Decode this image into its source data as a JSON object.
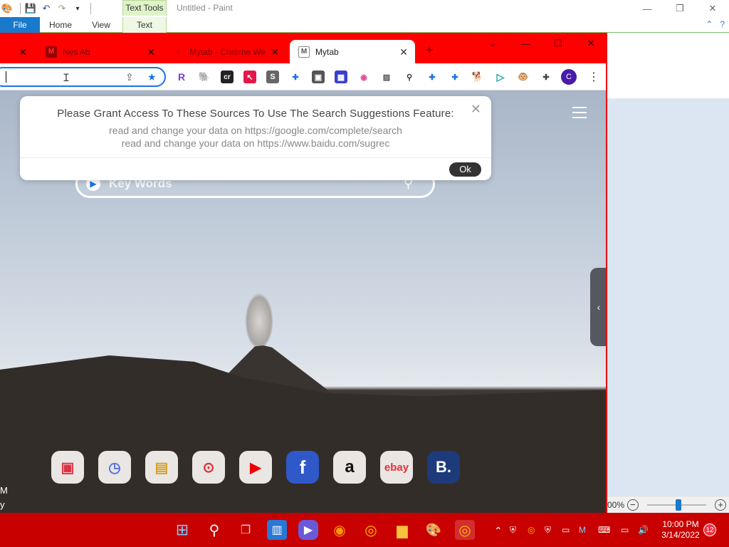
{
  "paint": {
    "title": "Untitled - Paint",
    "context_tab_group": "Text Tools",
    "ribbon_tabs": [
      "File",
      "Home",
      "View",
      "Text"
    ],
    "zoom_text": "00%",
    "window_buttons": [
      "—",
      "❐",
      "✕"
    ]
  },
  "chrome": {
    "tabs": [
      {
        "title": "",
        "favicon": "M",
        "active": false
      },
      {
        "title": "Nes Ab",
        "favicon": "M",
        "active": false
      },
      {
        "title": "Mytab - Chrome We",
        "favicon": "⌂",
        "active": false
      },
      {
        "title": "Mytab",
        "favicon": "M",
        "active": true
      }
    ],
    "new_tab_label": "+",
    "window_buttons": [
      "⌄",
      "—",
      "☐",
      "✕"
    ],
    "address_value": "",
    "profile_initial": "C",
    "extensions": [
      "R",
      "🐘",
      "cr",
      "↖",
      "S",
      "✚",
      "▣",
      "▦",
      "◉",
      "▨",
      "⚲",
      "✚",
      "✚",
      "🐕",
      "▷",
      "🐵",
      "✚"
    ]
  },
  "page": {
    "search_placeholder": "Key Words",
    "side_arrow": "‹",
    "quick_links": [
      "gallery",
      "clock",
      "notes",
      "games",
      "youtube",
      "facebook",
      "amazon",
      "ebay",
      "booking"
    ],
    "quick_link_glyphs": [
      "▣",
      "◷",
      "▤",
      "⊙",
      "▶",
      "f",
      "a",
      "ebay",
      "B."
    ],
    "edge_text": [
      "M",
      "y"
    ]
  },
  "popup": {
    "heading": "Please Grant Access To These Sources To Use The Search Suggestions Feature:",
    "lines": [
      "read and change your data on https://google.com/complete/search",
      "read and change your data on https://www.baidu.com/sugrec"
    ],
    "ok_label": "Ok",
    "close_label": "✕"
  },
  "taskbar": {
    "time": "10:00 PM",
    "date": "3/14/2022",
    "notification_count": "12",
    "apps": [
      "start",
      "search",
      "task-view",
      "widgets",
      "teams",
      "firefox",
      "chrome",
      "file-explorer",
      "paint",
      "chrome"
    ]
  },
  "colors": {
    "chrome_frame": "#ff0000",
    "taskbar": "#c80000",
    "paint_file_tab": "#1979ca",
    "omnibox_focus": "#1a73e8"
  }
}
